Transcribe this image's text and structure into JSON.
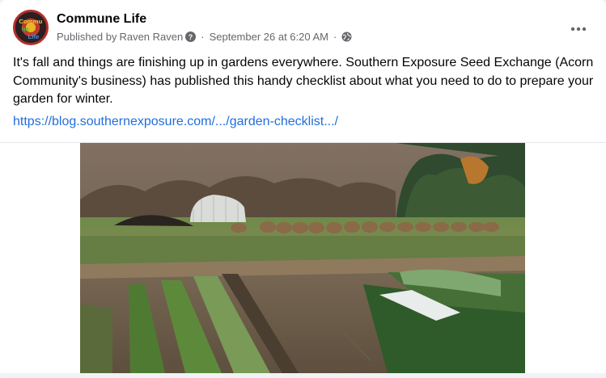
{
  "post": {
    "page_name": "Commune Life",
    "published_by_prefix": "Published by",
    "author": "Raven Raven",
    "date": "September 26 at 6:20 AM",
    "body": "It's fall and things are finishing up in gardens everywhere.  Southern Exposure Seed Exchange (Acorn Community's business) has published this handy checklist about what you need to do to prepare your garden for winter.",
    "link_text": "https://blog.southernexposure.com/.../garden-checklist.../"
  },
  "avatar": {
    "logo_text_1": "Commu",
    "logo_text_2": "ne",
    "logo_text_3": "Life"
  },
  "icons": {
    "more": "more-horizontal-icon",
    "help": "question-circle-icon",
    "audience": "globe-icon"
  },
  "colors": {
    "link": "#216fdb",
    "meta": "#65676b",
    "text": "#050505",
    "avatar_ring": "#b0302a"
  }
}
